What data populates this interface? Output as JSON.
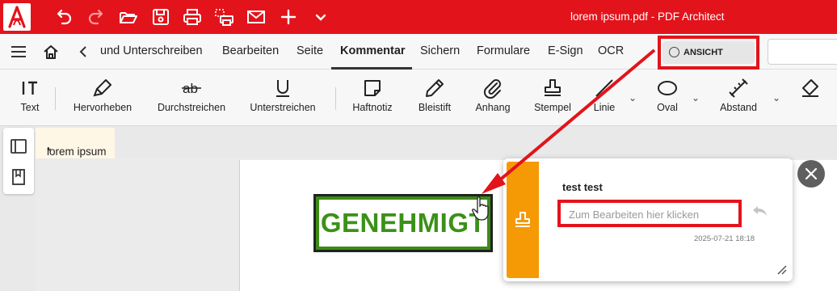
{
  "window": {
    "title": "lorem ipsum.pdf  -  PDF Architect"
  },
  "quick_access": [
    {
      "icon": "undo-icon"
    },
    {
      "icon": "redo-icon"
    },
    {
      "icon": "open-folder-icon"
    },
    {
      "icon": "save-icon"
    },
    {
      "icon": "print-icon"
    },
    {
      "icon": "scan-print-icon"
    },
    {
      "icon": "mail-icon"
    },
    {
      "icon": "plus-icon"
    },
    {
      "icon": "chevron-down-icon"
    }
  ],
  "menu": {
    "tabs": [
      "und Unterschreiben",
      "Bearbeiten",
      "Seite",
      "Kommentar",
      "Sichern",
      "Formulare",
      "E-Sign",
      "OCR"
    ],
    "active_tab": "Kommentar",
    "view_label": "ANSICHT"
  },
  "toolbar": {
    "text": "Text",
    "highlight": "Hervorheben",
    "strikethrough": "Durchstreichen",
    "underline": "Unterstreichen",
    "sticky_note": "Haftnotiz",
    "pencil": "Bleistift",
    "attachment": "Anhang",
    "stamp": "Stempel",
    "line": "Linie",
    "oval": "Oval",
    "distance": "Abstand"
  },
  "document": {
    "tab_label": "lorem ipsum",
    "modified_marker": "*",
    "stamp_text": "GENEHMIGT"
  },
  "comment": {
    "author": "test test",
    "placeholder": "Zum Bearbeiten hier klicken",
    "timestamp": "2025-07-21 18:18"
  },
  "colors": {
    "brand": "#e3131b",
    "stamp_green": "#3b9118",
    "popup_accent": "#f59a05",
    "highlight": "#e3131b"
  }
}
